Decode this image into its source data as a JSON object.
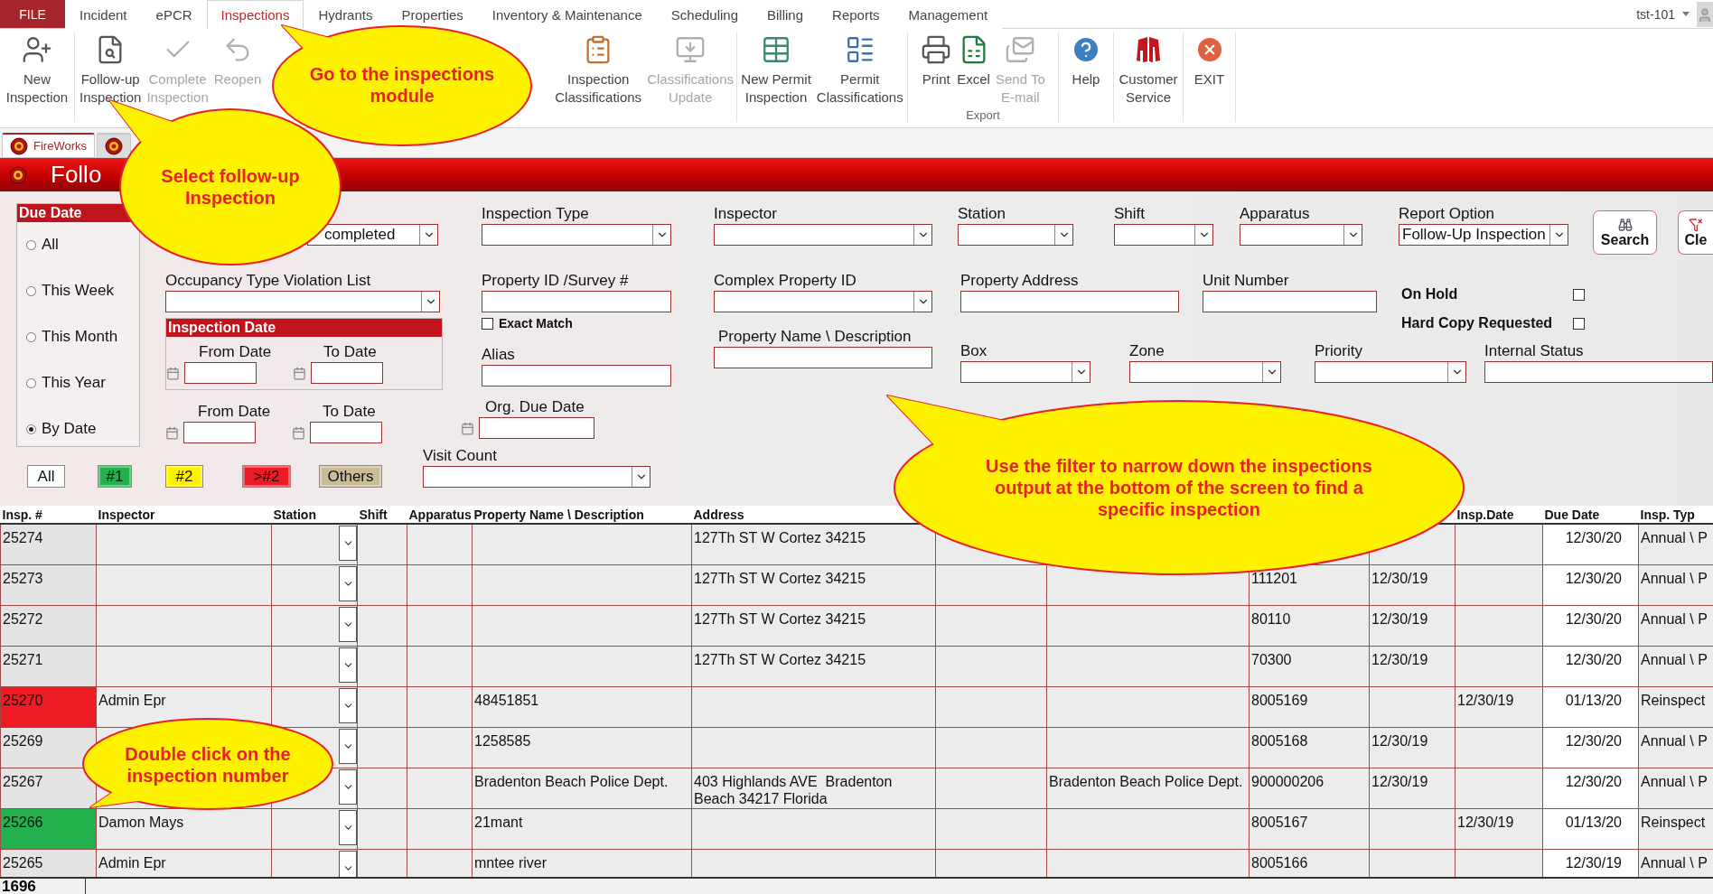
{
  "menu": {
    "file": "FILE",
    "tabs": [
      {
        "label": "Incident",
        "selected": false
      },
      {
        "label": "ePCR",
        "selected": false
      },
      {
        "label": "Inspections",
        "selected": true
      },
      {
        "label": "Hydrants",
        "selected": false
      },
      {
        "label": "Properties",
        "selected": false
      },
      {
        "label": "Inventory & Maintenance",
        "selected": false
      },
      {
        "label": "Scheduling",
        "selected": false
      },
      {
        "label": "Billing",
        "selected": false
      },
      {
        "label": "Reports",
        "selected": false
      },
      {
        "label": "Management",
        "selected": false
      }
    ],
    "user": "tst-101"
  },
  "ribbon": [
    {
      "items": [
        {
          "lines": [
            "New",
            "Inspection"
          ],
          "disabled": false
        }
      ]
    },
    {
      "items": [
        {
          "lines": [
            "Follow-up",
            "Inspection"
          ],
          "disabled": false
        },
        {
          "lines": [
            "Complete",
            "Inspection"
          ],
          "disabled": true
        },
        {
          "lines": [
            "Reopen"
          ],
          "disabled": true
        },
        {
          "lines": [
            "Inspection",
            "Classifications"
          ],
          "disabled": false
        },
        {
          "lines": [
            "Classifications",
            "Update"
          ],
          "disabled": true
        }
      ]
    },
    {
      "items": [
        {
          "lines": [
            "New Permit",
            "Inspection"
          ],
          "disabled": false
        },
        {
          "lines": [
            "Permit",
            "Classifications"
          ],
          "disabled": false
        }
      ]
    },
    {
      "label": "Export",
      "items": [
        {
          "lines": [
            "Print"
          ],
          "disabled": false
        },
        {
          "lines": [
            "Excel"
          ],
          "disabled": false
        },
        {
          "lines": [
            "Send To",
            "E-mail"
          ],
          "disabled": true
        }
      ]
    },
    {
      "items": [
        {
          "lines": [
            "Help"
          ],
          "disabled": false
        }
      ]
    },
    {
      "items": [
        {
          "lines": [
            "Customer",
            "Service"
          ],
          "disabled": false
        }
      ]
    },
    {
      "items": [
        {
          "lines": [
            "EXIT"
          ],
          "disabled": false
        }
      ]
    }
  ],
  "document_tabs": [
    {
      "kind": "labeled",
      "label": "FireWorks",
      "selected": true
    },
    {
      "kind": "covered",
      "selected": false
    }
  ],
  "header": {
    "title": "Follo"
  },
  "due_date": {
    "title": "Due Date",
    "options": [
      {
        "label": "All",
        "selected": false
      },
      {
        "label": "This Week",
        "selected": false
      },
      {
        "label": "This Month",
        "selected": false
      },
      {
        "label": "This Year",
        "selected": false
      },
      {
        "label": "By Date",
        "selected": true
      }
    ]
  },
  "filters": {
    "column_a": {
      "status_value": "completed",
      "occupancy": "Occupancy Type Violation List",
      "inspection_date": {
        "title": "Inspection Date",
        "from": "From Date",
        "to": "To Date"
      },
      "due_range": {
        "from": "From Date",
        "to": "To Date"
      }
    },
    "column_b": {
      "inspection_type": "Inspection Type",
      "property_id": "Property ID /Survey #",
      "exact_match": {
        "label": "Exact Match",
        "checked": false
      },
      "alias": "Alias",
      "org_due_date": "Org. Due Date",
      "visit_count": "Visit Count"
    },
    "column_c": {
      "inspector": "Inspector",
      "complex_property_id": "Complex Property ID",
      "property_name": "Property Name \\ Description"
    },
    "rows": [
      [
        {
          "kind": "combo",
          "label": "Station"
        },
        {
          "kind": "combo",
          "label": "Shift"
        },
        {
          "kind": "combo",
          "label": "Apparatus"
        },
        {
          "kind": "combo",
          "label": "Report Option",
          "value": "Follow-Up Inspection"
        },
        {
          "kind": "button",
          "label": "Search"
        },
        {
          "kind": "button",
          "label": "Cle"
        }
      ],
      [
        {
          "kind": "input",
          "label": "Property Address"
        },
        {
          "kind": "input",
          "label": "Unit Number"
        }
      ],
      [
        {
          "kind": "combo",
          "label": "Box"
        },
        {
          "kind": "combo",
          "label": "Zone"
        },
        {
          "kind": "combo",
          "label": "Priority"
        },
        {
          "kind": "input",
          "label": "Internal Status"
        }
      ]
    ],
    "flags": [
      {
        "label": "On Hold",
        "checked": false
      },
      {
        "label": "Hard Copy Requested",
        "checked": false
      }
    ]
  },
  "color_buttons": [
    {
      "label": "All",
      "color": "#ffffff"
    },
    {
      "label": "#1",
      "color": "#22b14c"
    },
    {
      "label": "#2",
      "color": "#fff200"
    },
    {
      "label": ">#2",
      "color": "#ed1c24"
    },
    {
      "label": "Others",
      "color": "#c8bd96"
    }
  ],
  "grid": {
    "columns": {
      "insp_no": "Insp. #",
      "inspector": "Inspector",
      "station": "Station",
      "shift": "Shift",
      "apparatus": "Apparatus",
      "property_name": "Property Name \\ Description",
      "address": "Address",
      "insp_date": "Insp.Date",
      "due_date": "Due Date",
      "insp_type": "Insp. Typ"
    },
    "rows": [
      {
        "insp_no": "25274",
        "address": "127Th ST W Cortez 34215",
        "due_date": "12/30/20",
        "insp_type": "Annual \\ P"
      },
      {
        "insp_no": "25273",
        "address": "127Th ST W Cortez 34215",
        "column_10": "111201",
        "column_11": "12/30/19",
        "due_date": "12/30/20",
        "insp_type": "Annual \\ P"
      },
      {
        "insp_no": "25272",
        "address": "127Th ST W Cortez 34215",
        "column_10": "80110",
        "column_11": "12/30/19",
        "due_date": "12/30/20",
        "insp_type": "Annual \\ P"
      },
      {
        "insp_no": "25271",
        "address": "127Th ST W Cortez 34215",
        "column_10": "70300",
        "column_11": "12/30/19",
        "due_date": "12/30/20",
        "insp_type": "Annual \\ P"
      },
      {
        "insp_no": "25270",
        "color": "#ed1c24",
        "inspector": "Admin Epr",
        "property_name": "48451851",
        "column_10": "8005169",
        "insp_date": "12/30/19",
        "due_date": "01/13/20",
        "insp_type": "Reinspect"
      },
      {
        "insp_no": "25269",
        "property_name": "1258585",
        "column_10": "8005168",
        "column_11": "12/30/19",
        "due_date": "12/30/20",
        "insp_type": "Annual \\ P"
      },
      {
        "insp_no": "25267",
        "property_name": "Bradenton Beach Police Dept.",
        "address": "403 Highlands AVE  Bradenton Beach 34217 Florida",
        "column_9": "Bradenton Beach Police Dept.",
        "column_10": "900000206",
        "column_11": "12/30/19",
        "due_date": "12/30/20",
        "insp_type": "Annual \\ P"
      },
      {
        "insp_no": "25266",
        "color": "#22b14c",
        "inspector": "Damon Mays",
        "property_name": "21mant",
        "column_10": "8005167",
        "insp_date": "12/30/19",
        "due_date": "01/13/20",
        "insp_type": "Reinspect"
      },
      {
        "insp_no": "25265",
        "inspector": "Admin Epr",
        "property_name": "mntee river",
        "column_10": "8005166",
        "due_date": "12/30/19",
        "insp_type": "Annual \\ P"
      }
    ]
  },
  "record_count": "1696",
  "callouts": [
    {
      "text": "Go to the inspections module"
    },
    {
      "text": "Select follow-up Inspection"
    },
    {
      "text": "Use the filter to narrow down the inspections output at the bottom of the screen to find a specific inspection"
    },
    {
      "text": "Double click on the inspection number"
    }
  ]
}
